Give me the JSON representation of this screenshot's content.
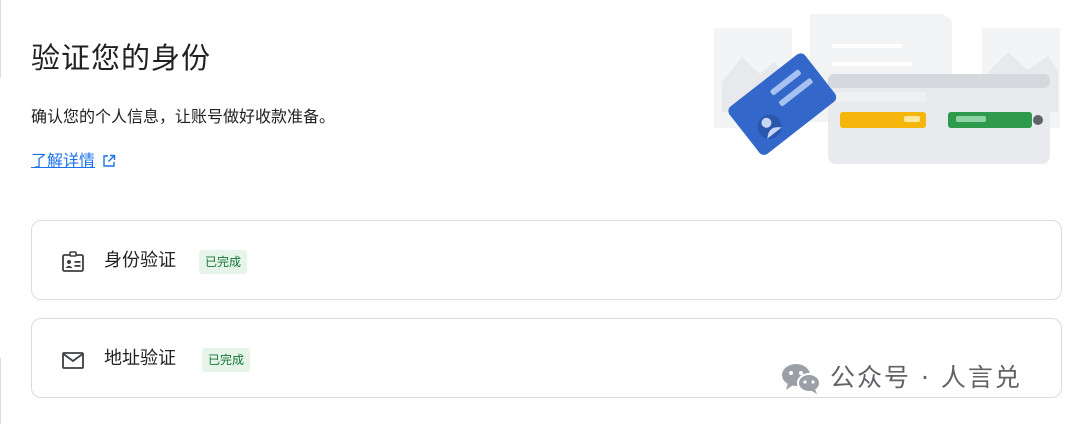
{
  "header": {
    "title": "验证您的身份",
    "subtitle": "确认您的个人信息，让账号做好收款准备。",
    "learn_more": "了解详情"
  },
  "steps": [
    {
      "label": "身份验证",
      "status": "已完成",
      "icon": "id-card-icon"
    },
    {
      "label": "地址验证",
      "status": "已完成",
      "icon": "mail-icon"
    }
  ],
  "watermark": {
    "text": "公众号 · 人言兑"
  },
  "colors": {
    "text": "#202124",
    "link": "#1a73e8",
    "border": "#dadce0",
    "badge_bg": "#e6f4ea",
    "badge_text": "#137333",
    "card_blue": "#3367c9",
    "yellow": "#f6b60e",
    "green": "#2e9a4c"
  }
}
